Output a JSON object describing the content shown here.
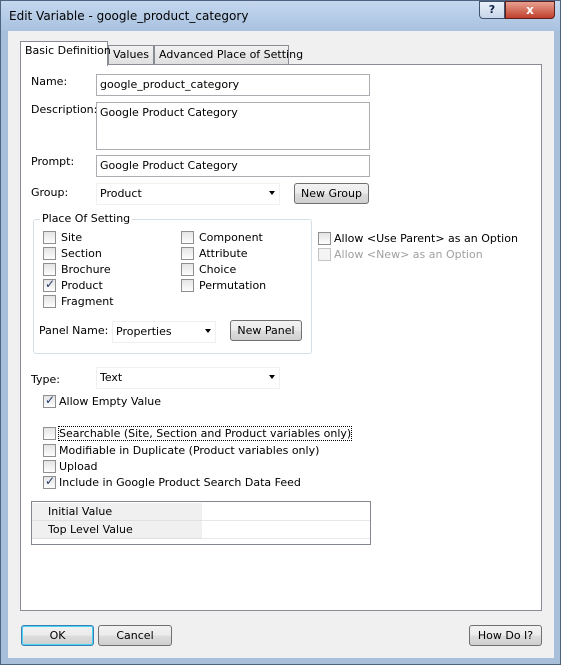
{
  "window": {
    "title": "Edit Variable - google_product_category",
    "help_glyph": "?",
    "close_glyph": "x"
  },
  "tabs": [
    {
      "label": "Basic Definition",
      "active": true
    },
    {
      "label": "Values",
      "active": false
    },
    {
      "label": "Advanced Place of Setting",
      "active": false
    }
  ],
  "form": {
    "name_label": "Name:",
    "name_value": "google_product_category",
    "description_label": "Description:",
    "description_value": "Google Product Category",
    "prompt_label": "Prompt:",
    "prompt_value": "Google Product Category",
    "group_label": "Group:",
    "group_value": "Product",
    "new_group_label": "New Group"
  },
  "place_of_setting": {
    "title": "Place Of Setting",
    "left": [
      {
        "label": "Site",
        "checked": false
      },
      {
        "label": "Section",
        "checked": false
      },
      {
        "label": "Brochure",
        "checked": false
      },
      {
        "label": "Product",
        "checked": true
      },
      {
        "label": "Fragment",
        "checked": false
      }
    ],
    "right": [
      {
        "label": "Component",
        "checked": false
      },
      {
        "label": "Attribute",
        "checked": false
      },
      {
        "label": "Choice",
        "checked": false
      },
      {
        "label": "Permutation",
        "checked": false
      }
    ],
    "panel_name_label": "Panel Name:",
    "panel_name_value": "Properties",
    "new_panel_label": "New Panel"
  },
  "options": {
    "allow_use_parent": {
      "label": "Allow <Use Parent> as an Option",
      "checked": false,
      "enabled": true
    },
    "allow_new": {
      "label": "Allow <New> as an Option",
      "checked": false,
      "enabled": false
    }
  },
  "type": {
    "label": "Type:",
    "value": "Text"
  },
  "flags": [
    {
      "label": "Allow Empty Value",
      "checked": true
    },
    {
      "label": "Searchable (Site, Section and Product variables only)",
      "checked": false
    },
    {
      "label": "Modifiable in Duplicate (Product variables only)",
      "checked": false
    },
    {
      "label": "Upload",
      "checked": false
    },
    {
      "label": "Include in Google Product Search Data Feed",
      "checked": true
    }
  ],
  "values_grid": [
    {
      "label": "Initial Value",
      "value": ""
    },
    {
      "label": "Top Level Value",
      "value": ""
    }
  ],
  "buttons": {
    "ok": "OK",
    "cancel": "Cancel",
    "how_do_i": "How Do I?"
  }
}
